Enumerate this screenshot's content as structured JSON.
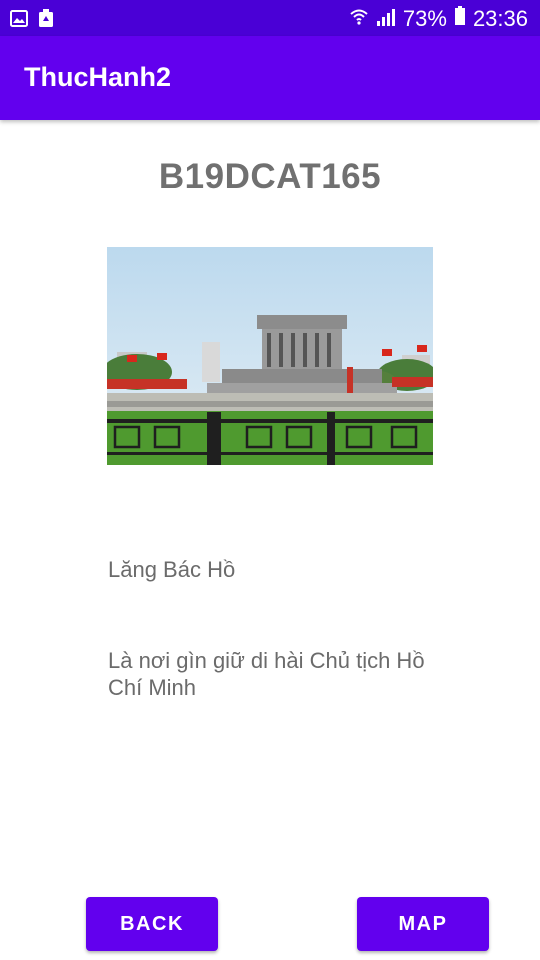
{
  "status_bar": {
    "left_icons": [
      "image-icon",
      "recycle-icon"
    ],
    "right_icons": [
      "wifi-icon",
      "signal-icon",
      "battery-icon"
    ],
    "battery_percent": "73%",
    "time": "23:36"
  },
  "app_bar": {
    "title": "ThucHanh2"
  },
  "main": {
    "code": "B19DCAT165",
    "place_name": "Lăng Bác Hồ",
    "description": "Là nơi gìn giữ di hài Chủ tịch Hồ Chí Minh"
  },
  "buttons": {
    "back_label": "BACK",
    "map_label": "MAP"
  },
  "colors": {
    "status_bar": "#4a00d6",
    "primary": "#6200ee",
    "text_gray": "#6b6b6b"
  }
}
